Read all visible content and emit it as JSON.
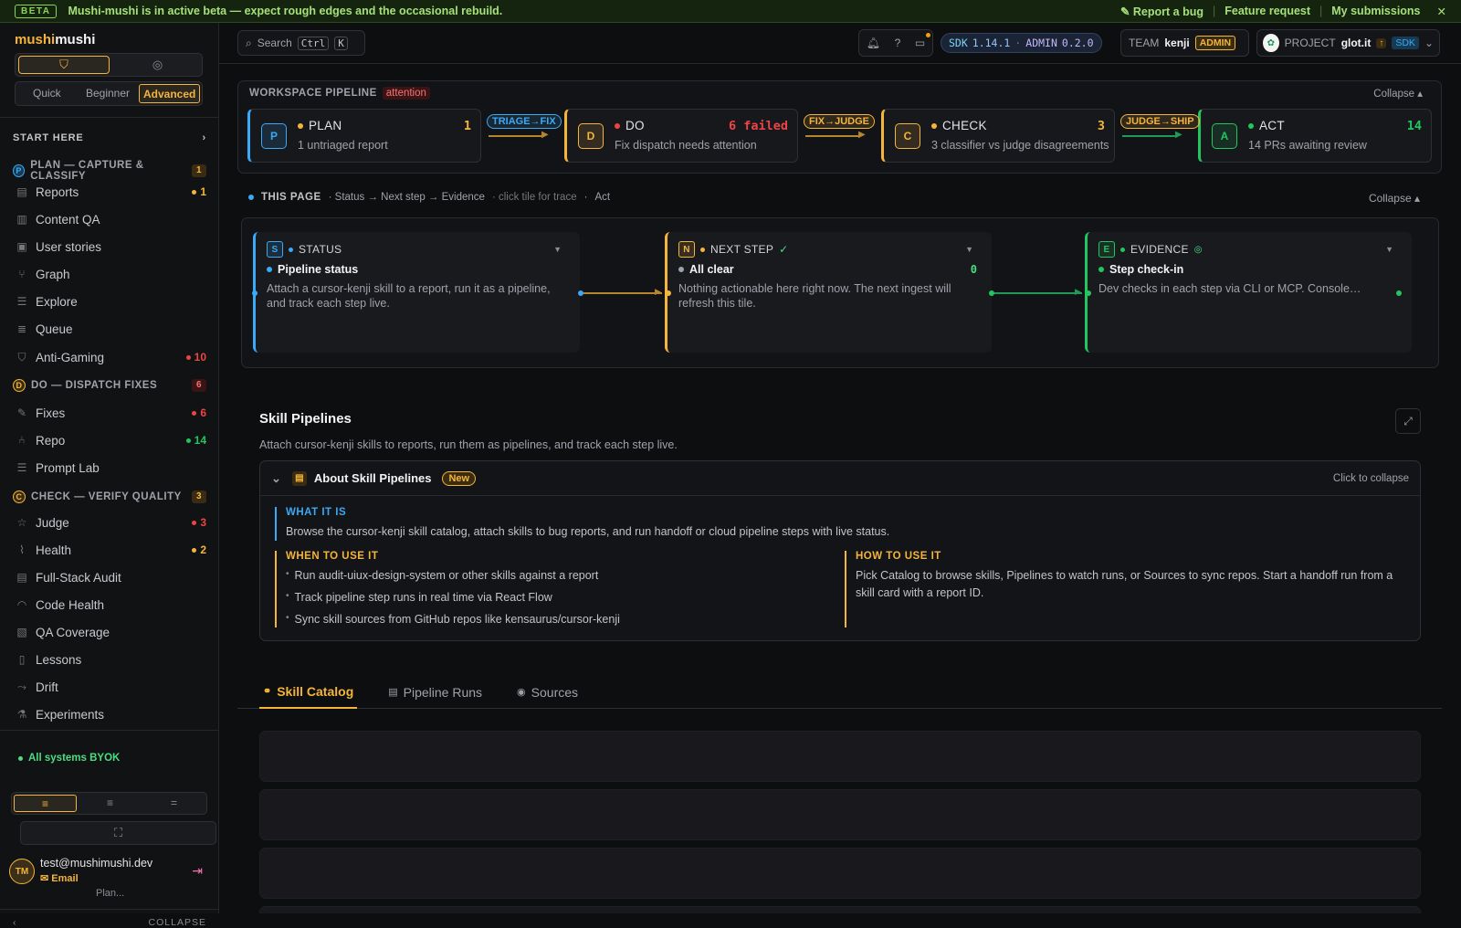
{
  "banner": {
    "tag": "BETA",
    "message": "Mushi-mushi is in active beta — expect rough edges and the occasional rebuild.",
    "report": "Report a bug",
    "feature": "Feature request",
    "mine": "My submissions",
    "sep": "|"
  },
  "sidebar": {
    "brand_a": "mushi",
    "brand_b": "mushi",
    "modes": [
      "Quick",
      "Beginner",
      "Advanced"
    ],
    "active_mode": "Advanced",
    "start_here": "START HERE",
    "sections": [
      {
        "letter": "P",
        "label": "PLAN — CAPTURE & CLASSIFY",
        "count": "1",
        "color": "#3ba9f5"
      },
      {
        "letter": "D",
        "label": "DO — DISPATCH FIXES",
        "count": "6",
        "color": "#f5b43a"
      },
      {
        "letter": "C",
        "label": "CHECK — VERIFY QUALITY",
        "count": "3",
        "color": "#f5b43a"
      }
    ],
    "items": [
      {
        "label": "Reports",
        "badge": "1",
        "badge_color": "#f5b43a",
        "icon": "document-icon"
      },
      {
        "label": "Content QA",
        "icon": "content-icon"
      },
      {
        "label": "User stories",
        "icon": "stories-icon"
      },
      {
        "label": "Graph",
        "icon": "graph-icon"
      },
      {
        "label": "Explore",
        "icon": "explore-icon"
      },
      {
        "label": "Queue",
        "icon": "queue-icon"
      },
      {
        "label": "Anti-Gaming",
        "badge": "10",
        "badge_color": "#ef4444",
        "icon": "shield-icon"
      },
      {
        "label": "Fixes",
        "badge": "6",
        "badge_color": "#ef4444",
        "icon": "wrench-icon"
      },
      {
        "label": "Repo",
        "badge": "14",
        "badge_color": "#22c55e",
        "icon": "git-icon"
      },
      {
        "label": "Prompt Lab",
        "icon": "lines-icon"
      },
      {
        "label": "Judge",
        "badge": "3",
        "badge_color": "#ef4444",
        "icon": "star-icon"
      },
      {
        "label": "Health",
        "badge": "2",
        "badge_color": "#f5b43a",
        "icon": "pulse-icon"
      },
      {
        "label": "Full-Stack Audit",
        "icon": "audit-icon"
      },
      {
        "label": "Code Health",
        "icon": "gauge-icon"
      },
      {
        "label": "QA Coverage",
        "icon": "coverage-icon"
      },
      {
        "label": "Lessons",
        "icon": "book-icon"
      },
      {
        "label": "Drift",
        "icon": "drift-icon"
      },
      {
        "label": "Experiments",
        "icon": "flask-icon"
      }
    ],
    "status": "All systems BYOK",
    "user": {
      "initials": "TM",
      "email": "test@mushimushi.dev",
      "type": "Email"
    },
    "plan": "Plan...",
    "collapse": "COLLAPSE"
  },
  "topbar": {
    "search": "Search",
    "k1": "Ctrl",
    "k2": "K",
    "help": "?",
    "sdk_label": "SDK",
    "sdk_ver": "1.14.1",
    "admin_label": "ADMIN",
    "admin_ver": "0.2.0",
    "team_label": "TEAM",
    "team": "kenji",
    "role": "ADMIN",
    "project_label": "PROJECT",
    "project": "glot.it",
    "sdk_tag": "SDK"
  },
  "pipeline": {
    "title": "WORKSPACE PIPELINE",
    "flag": "attention",
    "collapse": "Collapse ▴",
    "stages": [
      {
        "letter": "P",
        "name": "PLAN",
        "count": "1",
        "sub": "1 untriaged report",
        "color": "#3ba9f5",
        "dot": "#f5b43a",
        "count_color": "#f5b43a"
      },
      {
        "letter": "D",
        "name": "DO",
        "count": "6 failed",
        "sub": "Fix dispatch needs attention",
        "color": "#f5b43a",
        "dot": "#ef4444",
        "count_color": "#ef4444"
      },
      {
        "letter": "C",
        "name": "CHECK",
        "count": "3",
        "sub": "3 classifier vs judge disagreements",
        "color": "#f5b43a",
        "dot": "#f5b43a",
        "count_color": "#f5b43a"
      },
      {
        "letter": "A",
        "name": "ACT",
        "count": "14",
        "sub": "14 PRs awaiting review",
        "color": "#22c55e",
        "dot": "#22c55e",
        "count_color": "#22c55e"
      }
    ],
    "connectors": [
      {
        "label": "TRIAGE→FIX",
        "color": "#3ba9f5",
        "line": "#b5862c"
      },
      {
        "label": "FIX→JUDGE",
        "color": "#f5b43a",
        "line": "#b5862c"
      },
      {
        "label": "JUDGE→SHIP",
        "color": "#f5b43a",
        "line": "#1f9b55"
      }
    ]
  },
  "this_page": {
    "title": "THIS PAGE",
    "flow": "· Status → Next step → Evidence",
    "hint": "· click tile for trace",
    "dot": "·",
    "act": "Act",
    "collapse": "Collapse ▴",
    "cards": [
      {
        "letter": "S",
        "name": "STATUS",
        "title": "Pipeline status",
        "body": "Attach a cursor-kenji skill to a report, run it as a pipeline, and track each step live.",
        "color": "#3ba9f5"
      },
      {
        "letter": "N",
        "name": "NEXT STEP",
        "check": "✓",
        "title": "All clear",
        "zero": "0",
        "body": "Nothing actionable here right now. The next ingest will refresh this tile.",
        "color": "#f5b43a"
      },
      {
        "letter": "E",
        "name": "EVIDENCE",
        "title": "Step check-in",
        "body": "Dev checks in each step via CLI or MCP. Console…",
        "color": "#22c55e"
      }
    ]
  },
  "skill": {
    "title": "Skill Pipelines",
    "subtitle": "Attach cursor-kenji skills to reports, run them as pipelines, and track each step live.",
    "about": {
      "title": "About Skill Pipelines",
      "badge": "New",
      "collapse": "Click to collapse",
      "what_h": "WHAT IT IS",
      "what_p": "Browse the cursor-kenji skill catalog, attach skills to bug reports, and run handoff or cloud pipeline steps with live status.",
      "when_h": "WHEN TO USE IT",
      "when": [
        "Run audit-uiux-design-system or other skills against a report",
        "Track pipeline step runs in real time via React Flow",
        "Sync skill sources from GitHub repos like kensaurus/cursor-kenji"
      ],
      "how_h": "HOW TO USE IT",
      "how_p": "Pick Catalog to browse skills, Pipelines to watch runs, or Sources to sync repos. Start a handoff run from a skill card with a report ID."
    },
    "tabs": [
      "Skill Catalog",
      "Pipeline Runs",
      "Sources"
    ]
  }
}
